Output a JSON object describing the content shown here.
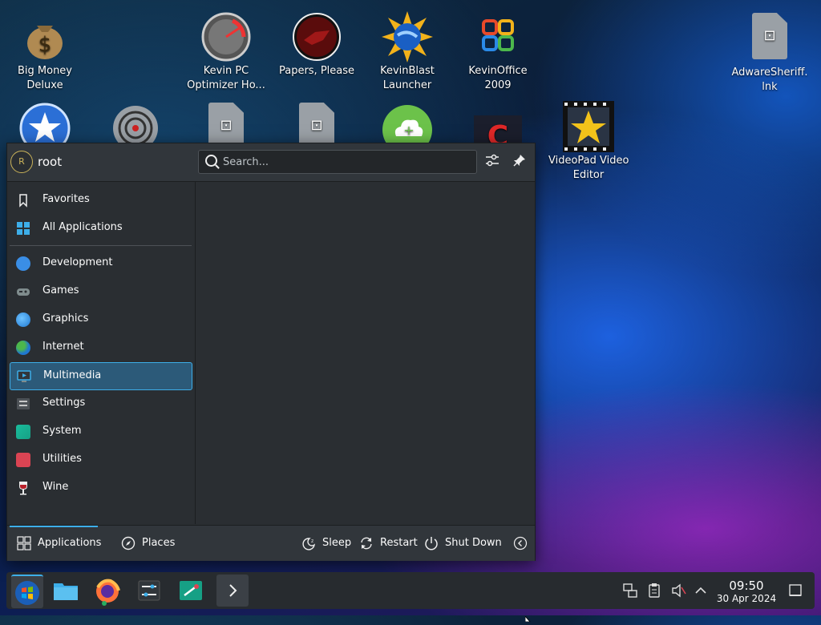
{
  "desktop": {
    "icons": [
      {
        "label": "Big Money\nDeluxe",
        "icon": "money-bag-icon"
      },
      {
        "label": "Kevin PC\nOptimizer Ho...",
        "icon": "speedometer-icon"
      },
      {
        "label": "Papers, Please",
        "icon": "papers-please-icon"
      },
      {
        "label": "KevinBlast\nLauncher",
        "icon": "sun-globe-icon"
      },
      {
        "label": "KevinOffice\n2009",
        "icon": "office-logo-icon"
      },
      {
        "label": "AdwareSheriff.\nlnk",
        "icon": "link-file-icon"
      },
      {
        "label": "VideoPad Video\nEditor",
        "icon": "film-star-icon"
      }
    ],
    "partial_icons": [
      "sheriff-star-icon",
      "target-icon",
      "link-file-icon",
      "link-file-icon",
      "cloud-plus-icon",
      "red-c-icon"
    ]
  },
  "launcher": {
    "user": {
      "initial": "R",
      "name": "root"
    },
    "search": {
      "placeholder": "Search...",
      "value": ""
    },
    "header_buttons": [
      "settings-sliders-icon",
      "pin-icon"
    ],
    "categories": [
      {
        "label": "Favorites",
        "icon": "bookmark-icon"
      },
      {
        "label": "All Applications",
        "icon": "grid-icon"
      },
      {
        "label": "Development",
        "icon": "development-icon"
      },
      {
        "label": "Games",
        "icon": "gamepad-icon"
      },
      {
        "label": "Graphics",
        "icon": "graphics-icon"
      },
      {
        "label": "Internet",
        "icon": "globe-icon"
      },
      {
        "label": "Multimedia",
        "icon": "multimedia-icon",
        "selected": true
      },
      {
        "label": "Settings",
        "icon": "settings-icon"
      },
      {
        "label": "System",
        "icon": "system-icon"
      },
      {
        "label": "Utilities",
        "icon": "utilities-icon"
      },
      {
        "label": "Wine",
        "icon": "wine-glass-icon"
      }
    ],
    "footer": {
      "applications_tab": "Applications",
      "places_tab": "Places",
      "sleep": "Sleep",
      "restart": "Restart",
      "shutdown": "Shut Down"
    }
  },
  "taskbar": {
    "clock_time": "09:50",
    "clock_date": "30 Apr 2024"
  },
  "colors": {
    "accent": "#3daee9",
    "selection": "#2c5a79",
    "panel": "#2a2e32",
    "header": "#31363b"
  }
}
